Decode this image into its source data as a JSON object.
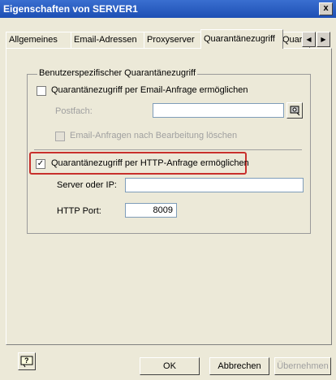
{
  "window": {
    "title": "Eigenschaften von SERVER1",
    "close_glyph": "x"
  },
  "tabs": [
    {
      "label": "Allgemeines"
    },
    {
      "label": "Email-Adressen"
    },
    {
      "label": "Proxyserver"
    },
    {
      "label": "Quarantänezugriff",
      "active": true
    },
    {
      "label": "Quara"
    }
  ],
  "group": {
    "title": "Benutzerspezifischer Quarantänezugriff",
    "email": {
      "label": "Quarantänezugriff per Email-Anfrage ermöglichen",
      "checked": false,
      "mailbox_label": "Postfach:",
      "mailbox_value": "",
      "delete_label": "Email-Anfragen nach Bearbeitung löschen"
    },
    "http": {
      "label": "Quarantänezugriff per HTTP-Anfrage ermöglichen",
      "checked": true,
      "check_glyph": "✓",
      "server_label": "Server oder IP:",
      "server_value": "",
      "port_label": "HTTP Port:",
      "port_value": "8009"
    }
  },
  "buttons": {
    "ok": "OK",
    "cancel": "Abbrechen",
    "apply": "Übernehmen"
  }
}
